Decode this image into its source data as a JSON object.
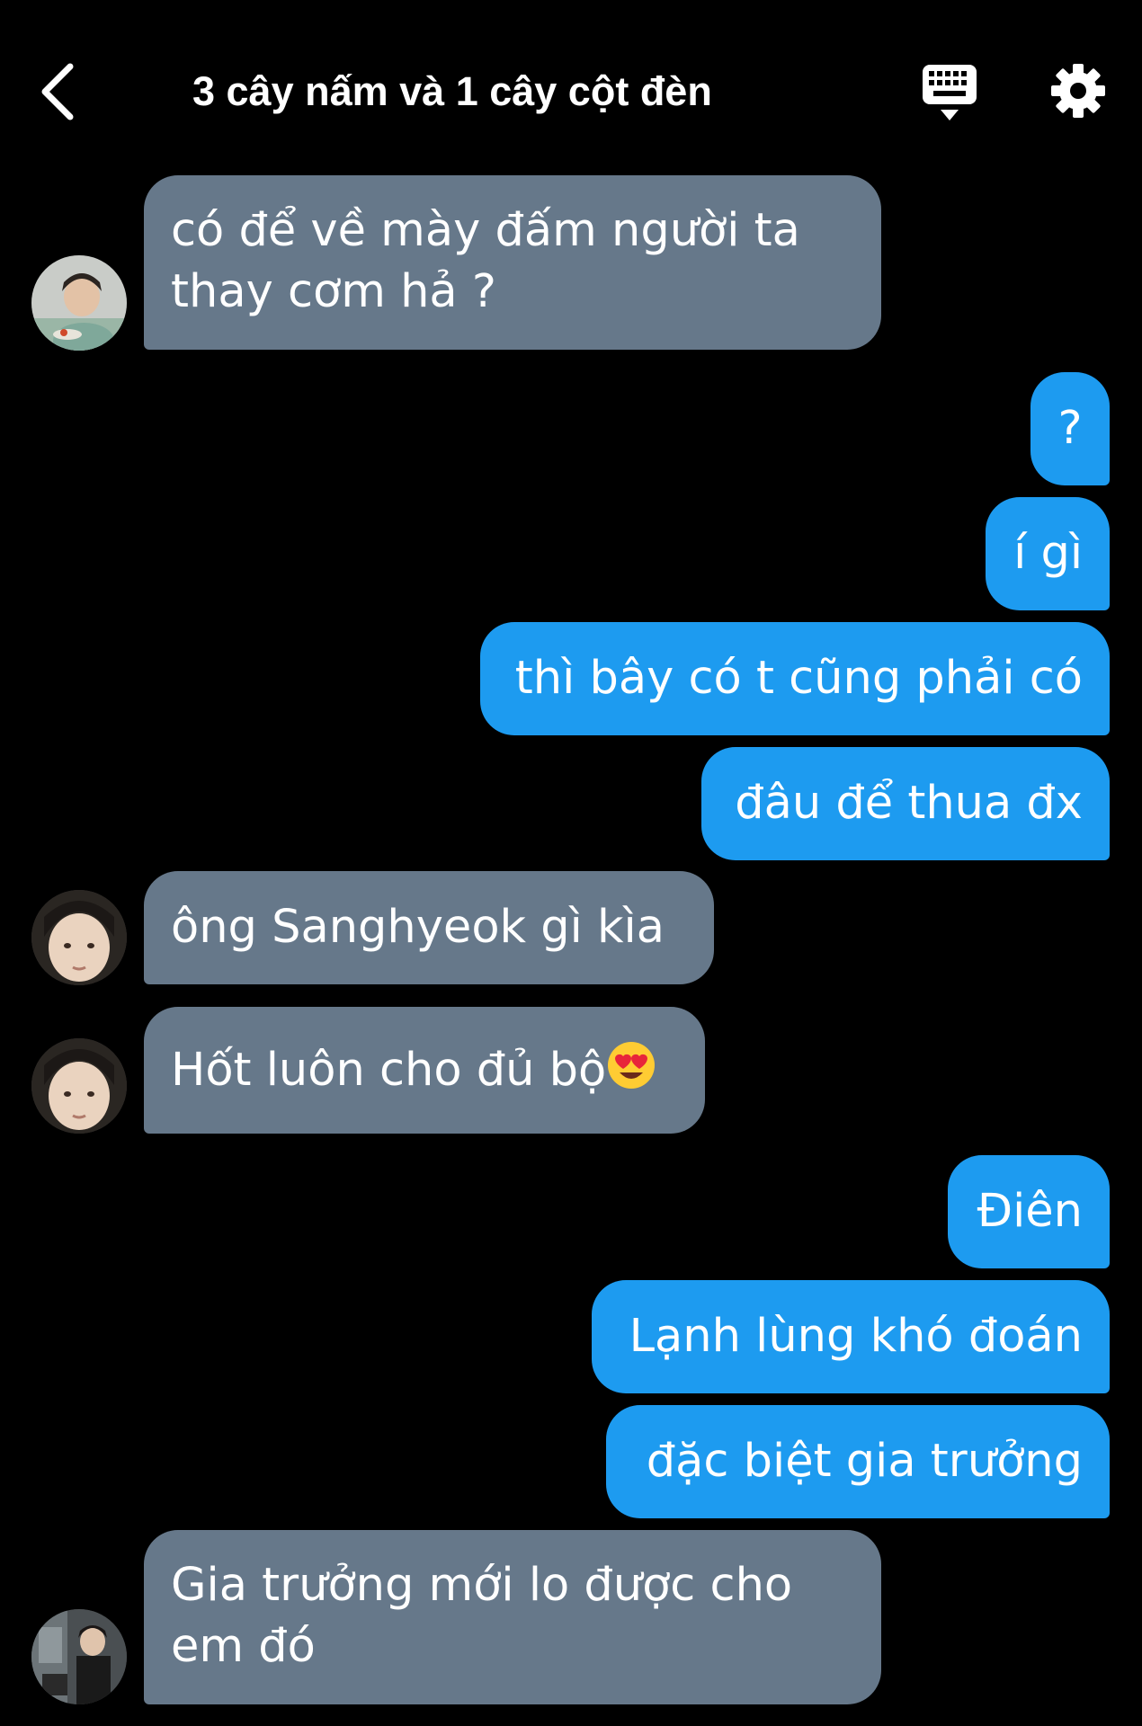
{
  "header": {
    "title": "3 cây nấm và 1 cây cột đèn"
  },
  "messages": [
    {
      "side": "in",
      "text": "có để về mày đấm người ta\nthay cơm hả ?"
    },
    {
      "side": "out",
      "text": "?"
    },
    {
      "side": "out",
      "text": "í gì"
    },
    {
      "side": "out",
      "text": "thì bây có t cũng phải có"
    },
    {
      "side": "out",
      "text": "đâu để thua đx"
    },
    {
      "side": "in",
      "text": "ông Sanghyeok gì kìa"
    },
    {
      "side": "in",
      "text": "Hốt luôn cho đủ bộ"
    },
    {
      "side": "out",
      "text": "Điên"
    },
    {
      "side": "out",
      "text": "Lạnh lùng khó đoán"
    },
    {
      "side": "out",
      "text": "đặc biệt gia trưởng"
    },
    {
      "side": "in",
      "text": "Gia trưởng mới lo được cho\nem đó"
    }
  ],
  "emoji": {
    "message_7": "heart-eyes-emoji"
  },
  "icons": {
    "back": "chevron-left-icon",
    "keyboard": "keyboard-icon",
    "settings": "gear-icon"
  },
  "colors": {
    "background": "#000000",
    "incoming_bubble": "#66788a",
    "outgoing_bubble": "#1d9bf0",
    "text": "#ffffff"
  }
}
